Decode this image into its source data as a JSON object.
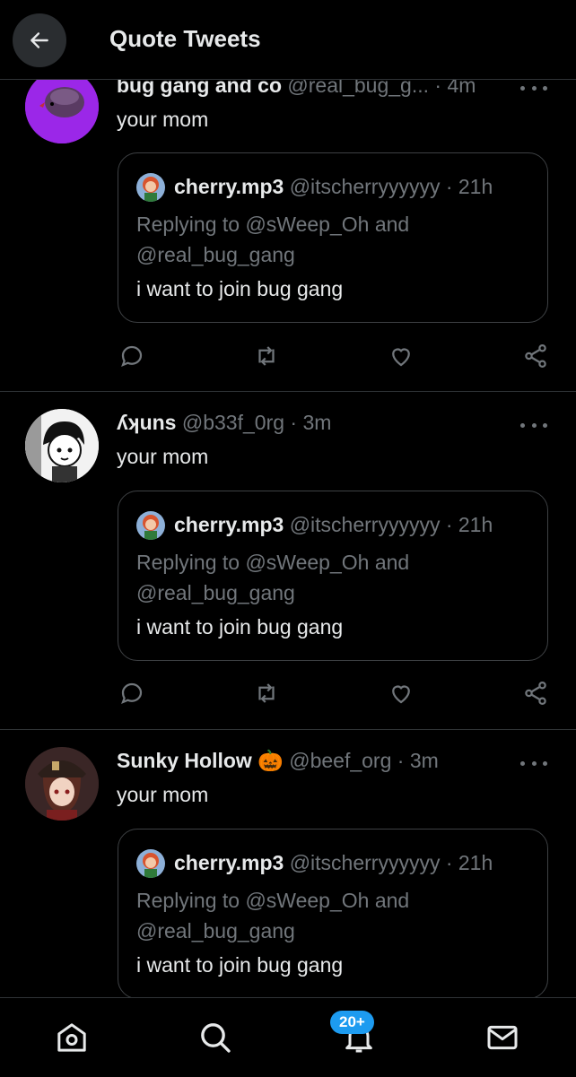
{
  "header": {
    "title": "Quote Tweets"
  },
  "tweets": [
    {
      "name": "bug gang and co",
      "handle": "@real_bug_g...",
      "time": "· 4m",
      "text": "your mom",
      "quote": {
        "name": "cherry.mp3",
        "handle": "@itscherryyyyyy",
        "time": "· 21h",
        "reply_line1": "Replying to @sWeep_Oh and",
        "reply_line2": "@real_bug_gang",
        "text": "i want to join bug gang"
      }
    },
    {
      "name": "ʎʞuns",
      "handle": "@b33f_0rg",
      "time": "· 3m",
      "text": "your mom",
      "quote": {
        "name": "cherry.mp3",
        "handle": "@itscherryyyyyy",
        "time": "· 21h",
        "reply_line1": "Replying to @sWeep_Oh and",
        "reply_line2": "@real_bug_gang",
        "text": "i want to join bug gang"
      }
    },
    {
      "name": "Sunky Hollow",
      "emoji": "🎃",
      "handle": "@beef_org",
      "time": "· 3m",
      "text": "your mom",
      "quote": {
        "name": "cherry.mp3",
        "handle": "@itscherryyyyyy",
        "time": "· 21h",
        "reply_line1": "Replying to @sWeep_Oh and",
        "reply_line2": "@real_bug_gang",
        "text": "i want to join bug gang"
      }
    }
  ],
  "bottom_nav": {
    "notifications_badge": "20+"
  },
  "colors": {
    "background": "#000000",
    "text": "#e7e9ea",
    "muted": "#71767b",
    "divider": "#2f3336",
    "accent": "#1d9bf0"
  }
}
